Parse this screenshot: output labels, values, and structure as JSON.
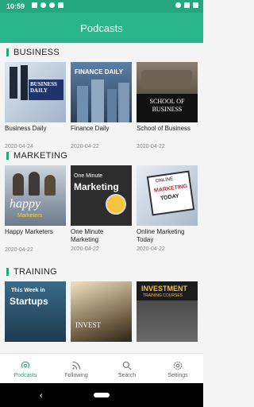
{
  "status": {
    "time": "10:59"
  },
  "app": {
    "title": "Podcasts"
  },
  "sections": [
    {
      "title": "BUSINESS",
      "items": [
        {
          "title": "Business Daily",
          "date": "2020-04-24",
          "thumb_text": "BUSINESS DAILY"
        },
        {
          "title": "Finance Daily",
          "date": "2020-04-22",
          "thumb_text": "FINANCE DAILY"
        },
        {
          "title": "School of Business",
          "date": "2020-04-22",
          "thumb_text": "SCHOOL OF BUSINESS"
        }
      ]
    },
    {
      "title": "MARKETING",
      "items": [
        {
          "title": "Happy Marketers",
          "date": "2020-04-22",
          "thumb_text_1": "happy",
          "thumb_text_2": "Marketers"
        },
        {
          "title": "One Minute Marketing",
          "date": "2020-04-22",
          "thumb_text_1": "One Minute",
          "thumb_text_2": "Marketing"
        },
        {
          "title": "Online Marketing Today",
          "date": "2020-04-22",
          "thumb_text_1": "ONLINE",
          "thumb_text_2": "MARKETING",
          "thumb_text_3": "TODAY"
        }
      ]
    },
    {
      "title": "TRAINING",
      "items": [
        {
          "thumb_text_1": "This Week in",
          "thumb_text_2": "Startups"
        },
        {
          "thumb_text_1": "INVEST"
        },
        {
          "thumb_text_1": "INVESTMENT",
          "thumb_text_2": "TRAINING COURSES"
        }
      ]
    }
  ],
  "nav": {
    "podcasts": "Podcasts",
    "following": "Following",
    "search": "Search",
    "settings": "Settings"
  },
  "colors": {
    "accent": "#2bb58a",
    "status_bar": "#25a77e"
  }
}
